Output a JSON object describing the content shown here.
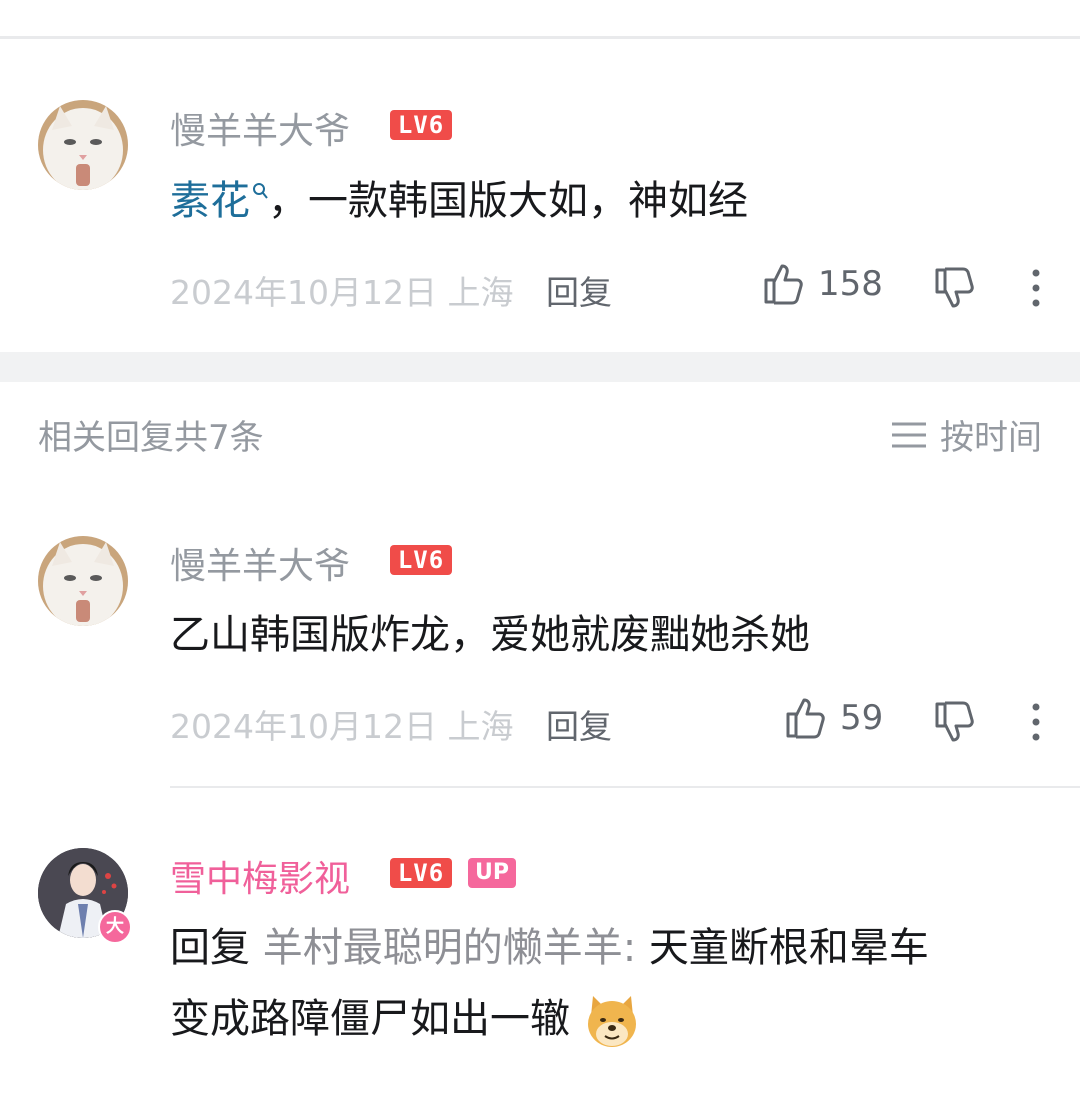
{
  "main_comment": {
    "username": "慢羊羊大爷",
    "level": "LV6",
    "keyword": "素花",
    "text": "，一款韩国版大如，神如经",
    "date": "2024年10月12日",
    "location": "上海",
    "reply_label": "回复",
    "likes": "158"
  },
  "replies_section": {
    "header": "相关回复共7条",
    "sort_label": "按时间"
  },
  "replies": [
    {
      "username": "慢羊羊大爷",
      "level": "LV6",
      "text": "乙山韩国版炸龙，爱她就废黜她杀她",
      "date": "2024年10月12日",
      "location": "上海",
      "reply_label": "回复",
      "likes": "59"
    },
    {
      "username": "雪中梅影视",
      "level": "LV6",
      "up_badge": "UP",
      "reply_prefix": "回复",
      "mention": "羊村最聪明的懒羊羊:",
      "text_line1": " 天童断根和晕车",
      "text_line2": "变成路障僵尸如出一辙",
      "avatar_badge": "大"
    }
  ],
  "colors": {
    "level_badge": "#f04c49",
    "up_badge": "#f5689c",
    "pink_username": "#f0609a",
    "keyword_link": "#1e6e9a"
  }
}
